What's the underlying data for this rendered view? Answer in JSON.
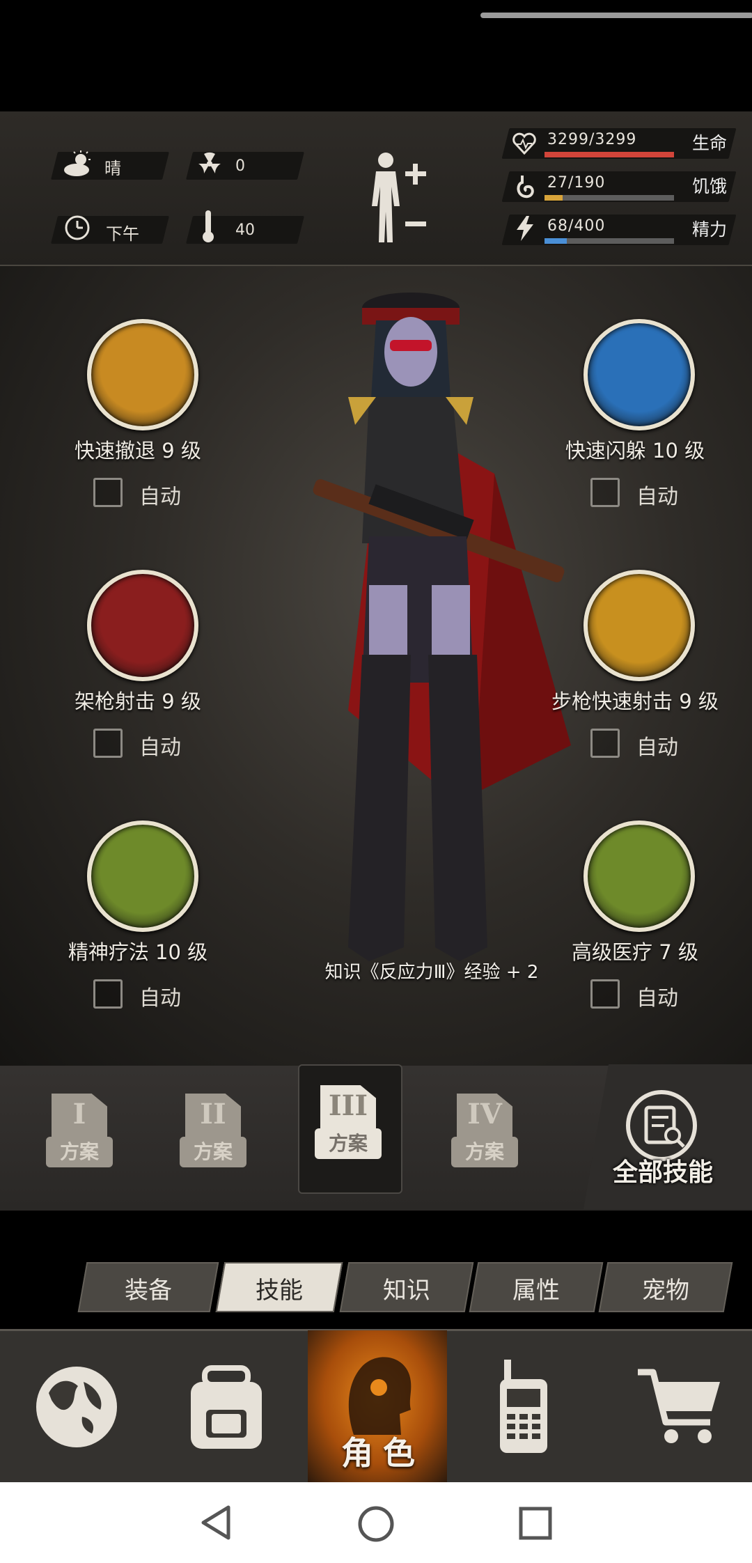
{
  "status": {
    "weather": "晴",
    "radiation": "0",
    "time_of_day": "下午",
    "temperature": "40"
  },
  "vitals": [
    {
      "value": "3299/3299",
      "label": "生命",
      "fraction": 1.0,
      "color": "#d2453a"
    },
    {
      "value": "27/190",
      "label": "饥饿",
      "fraction": 0.142,
      "color": "#d8a43a"
    },
    {
      "value": "68/400",
      "label": "精力",
      "fraction": 0.17,
      "color": "#4a8fd6"
    }
  ],
  "skills": [
    {
      "name": "快速撤退 9 级",
      "auto": "自动",
      "color": "#c88a22"
    },
    {
      "name": "快速闪躲 10 级",
      "auto": "自动",
      "color": "#2a70b8"
    },
    {
      "name": "架枪射击 9 级",
      "auto": "自动",
      "color": "#8a1e1e"
    },
    {
      "name": "步枪快速射击 9 级",
      "auto": "自动",
      "color": "#c8901f"
    },
    {
      "name": "精神疗法 10 级",
      "auto": "自动",
      "color": "#6e8a2a"
    },
    {
      "name": "高级医疗 7 级",
      "auto": "自动",
      "color": "#6e8a2a"
    }
  ],
  "notice": "知识《反应力Ⅲ》经验 + 2",
  "schemes": [
    {
      "numeral": "I",
      "label": "方案"
    },
    {
      "numeral": "II",
      "label": "方案"
    },
    {
      "numeral": "III",
      "label": "方案"
    },
    {
      "numeral": "IV",
      "label": "方案"
    }
  ],
  "all_skills": "全部技能",
  "tabs": [
    "装备",
    "技能",
    "知识",
    "属性",
    "宠物"
  ],
  "nav": {
    "role_label": "角色"
  }
}
